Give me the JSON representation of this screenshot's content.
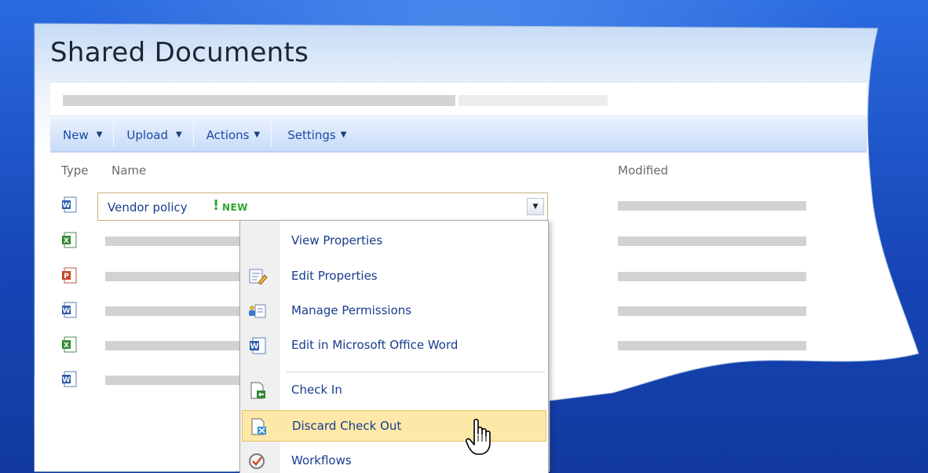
{
  "page": {
    "title": "Shared Documents"
  },
  "toolbar": {
    "items": [
      {
        "label": "New"
      },
      {
        "label": "Upload"
      },
      {
        "label": "Actions"
      },
      {
        "label": "Settings"
      }
    ]
  },
  "columns": {
    "type": "Type",
    "name": "Name",
    "modified": "Modified"
  },
  "rows": [
    {
      "icon": "word-doc-icon",
      "name": "Vendor policy",
      "new_badge": "NEW",
      "exclaim": "!"
    },
    {
      "icon": "excel-doc-icon"
    },
    {
      "icon": "powerpoint-doc-icon"
    },
    {
      "icon": "word-doc-icon"
    },
    {
      "icon": "excel-doc-icon"
    },
    {
      "icon": "word-doc-icon"
    }
  ],
  "context_menu": {
    "items": [
      {
        "label": "View Properties",
        "icon": ""
      },
      {
        "label": "Edit Properties",
        "icon": "edit-properties-icon"
      },
      {
        "label": "Manage Permissions",
        "icon": "manage-permissions-icon"
      },
      {
        "label": "Edit in Microsoft Office Word",
        "icon": "word-doc-icon"
      },
      {
        "label": "Check In",
        "icon": "check-in-icon"
      },
      {
        "label": "Discard Check Out",
        "icon": "discard-check-out-icon",
        "highlighted": true
      },
      {
        "label": "Workflows",
        "icon": "workflows-icon"
      }
    ]
  },
  "colors": {
    "background": "#1f57cc",
    "toolbar_text": "#1c4aa6",
    "link_text": "#173c8c",
    "highlight": "#fde8a8",
    "new_badge": "#2da52d"
  }
}
